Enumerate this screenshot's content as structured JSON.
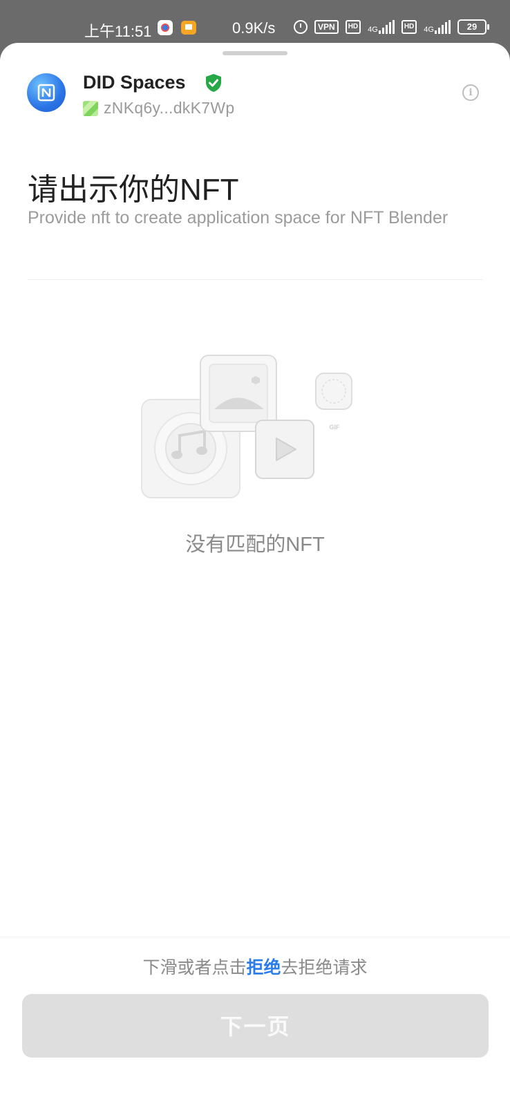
{
  "status_bar": {
    "time": "上午11:51",
    "net_speed": "0.9K/s",
    "vpn": "VPN",
    "hd1": "HD",
    "sig1": "4G",
    "hd2": "HD",
    "sig2": "4G",
    "battery": "29"
  },
  "header": {
    "app_name": "DID Spaces",
    "did_address": "zNKq6y...dkK7Wp"
  },
  "main": {
    "title": "请出示你的NFT",
    "description": "Provide nft to create application space for NFT Blender",
    "empty_text": "没有匹配的NFT",
    "gif_label": "GIF"
  },
  "footer": {
    "hint_before": "下滑或者点击",
    "hint_link": "拒绝",
    "hint_after": "去拒绝请求",
    "next_label": "下一页"
  },
  "colors": {
    "accent": "#2b7de9",
    "verified": "#27a846",
    "button_disabled": "#dedede"
  }
}
